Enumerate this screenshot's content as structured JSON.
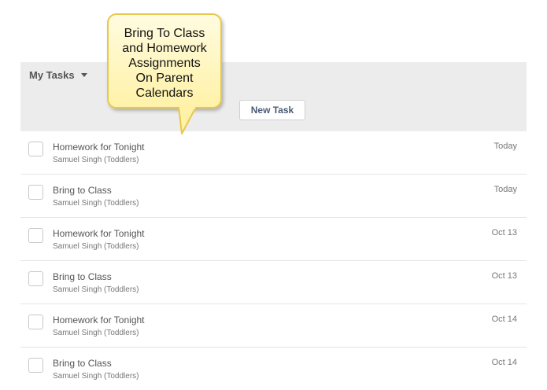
{
  "header": {
    "title": "My Tasks",
    "new_task_label": "New Task"
  },
  "tasks": [
    {
      "title": "Homework for Tonight",
      "subtitle": "Samuel Singh (Toddlers)",
      "date": "Today"
    },
    {
      "title": "Bring to Class",
      "subtitle": "Samuel Singh (Toddlers)",
      "date": "Today"
    },
    {
      "title": "Homework for Tonight",
      "subtitle": "Samuel Singh (Toddlers)",
      "date": "Oct 13"
    },
    {
      "title": "Bring to Class",
      "subtitle": "Samuel Singh (Toddlers)",
      "date": "Oct 13"
    },
    {
      "title": "Homework for Tonight",
      "subtitle": "Samuel Singh (Toddlers)",
      "date": "Oct 14"
    },
    {
      "title": "Bring to Class",
      "subtitle": "Samuel Singh (Toddlers)",
      "date": "Oct 14"
    }
  ],
  "callout": {
    "lines": [
      "Bring To Class",
      "and Homework",
      "Assignments",
      "On Parent",
      "Calendars"
    ]
  },
  "colors": {
    "header_bg": "#ececec",
    "button_text": "#4a5a75",
    "callout_fill": "#fff2a8",
    "callout_border": "#e8c84c"
  }
}
